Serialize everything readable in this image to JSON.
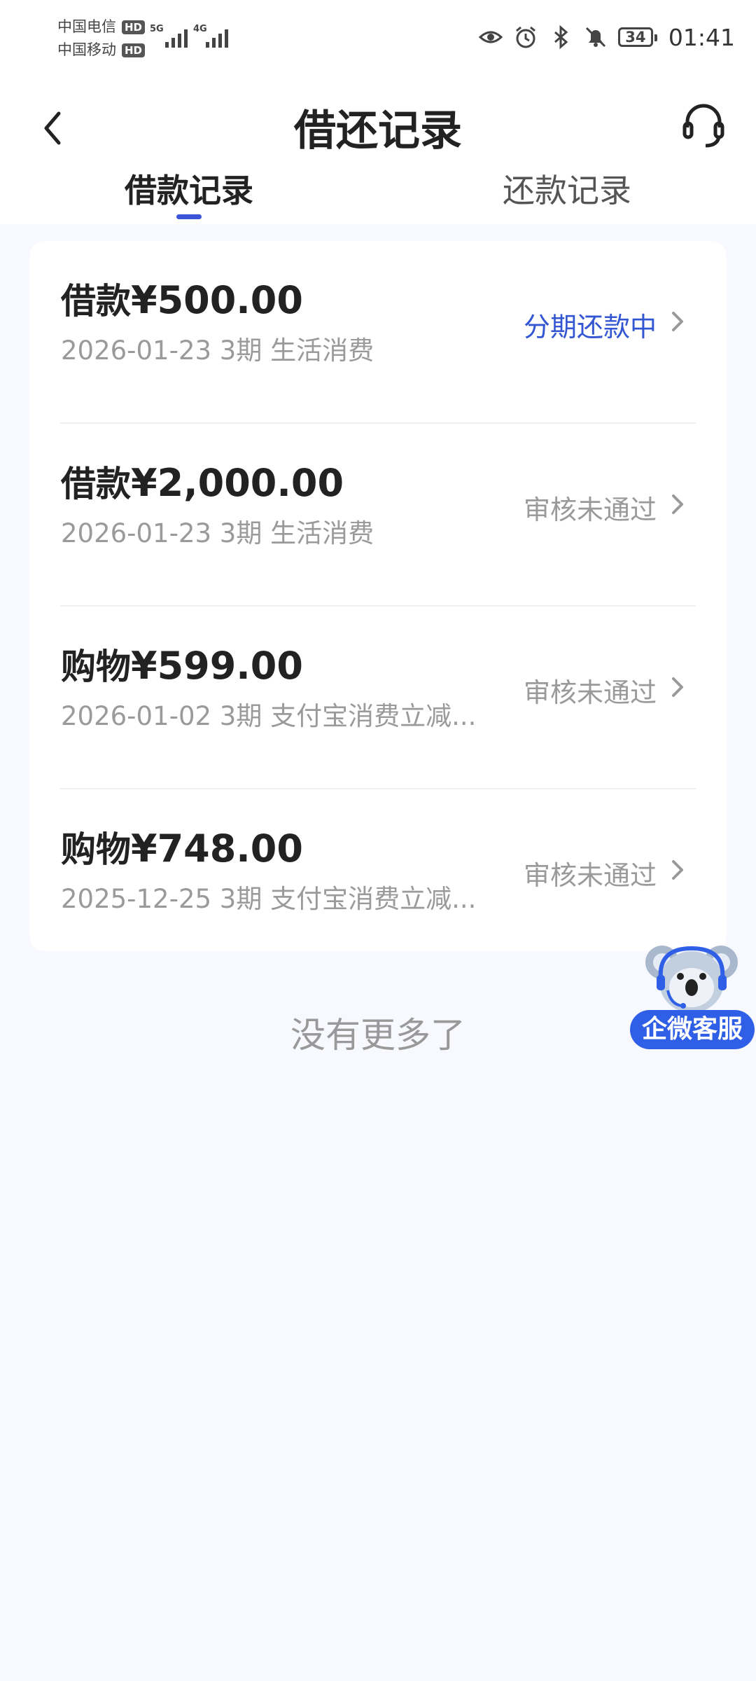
{
  "status_bar": {
    "carrier_1": "中国电信",
    "carrier_2": "中国移动",
    "hd_badge": "HD",
    "network_1": "5G",
    "network_2": "4G",
    "battery_level": "34",
    "time": "01:41"
  },
  "header": {
    "title": "借还记录",
    "back_icon": "chevron-left-icon",
    "support_icon": "headset-icon"
  },
  "tabs": [
    {
      "label": "借款记录",
      "active": true
    },
    {
      "label": "还款记录",
      "active": false
    }
  ],
  "records": [
    {
      "type": "借款",
      "amount": "¥500.00",
      "meta": "2026-01-23 3期  生活消费",
      "status": "分期还款中",
      "status_active": true
    },
    {
      "type": "借款",
      "amount": "¥2,000.00",
      "meta": "2026-01-23 3期  生活消费",
      "status": "审核未通过",
      "status_active": false
    },
    {
      "type": "购物",
      "amount": "¥599.00",
      "meta": "2026-01-02 3期  支付宝消费立减...",
      "status": "审核未通过",
      "status_active": false
    },
    {
      "type": "购物",
      "amount": "¥748.00",
      "meta": "2025-12-25 3期  支付宝消费立减...",
      "status": "审核未通过",
      "status_active": false
    }
  ],
  "list_footer": "没有更多了",
  "floating_service": {
    "label": "企微客服",
    "mascot_icon": "koala-mascot-icon"
  },
  "colors": {
    "accent": "#3a55d8",
    "status_active": "#3356d3",
    "status_muted": "#9a9a9a",
    "background": "#f7f9fe"
  }
}
